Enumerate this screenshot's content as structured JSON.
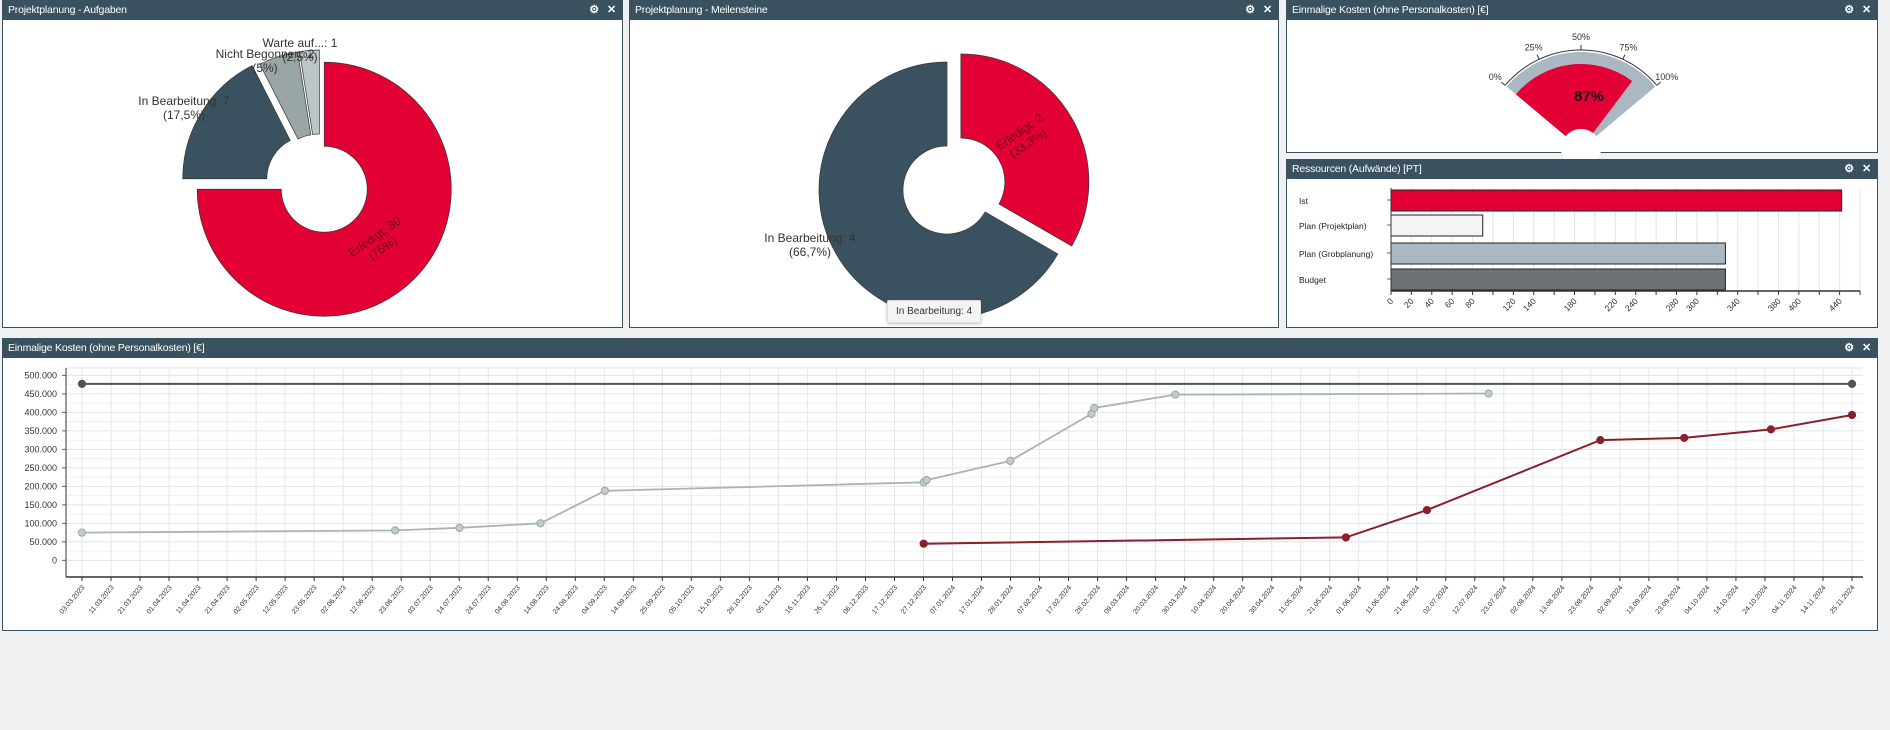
{
  "colors": {
    "header": "#3a525f",
    "red": "#e30034",
    "dark": "#3a525f",
    "gray": "#9aa5a6",
    "light": "#bcc5c8",
    "lineDark": "#4d5558",
    "lineGray": "#aab4b4",
    "lineRed": "#8b1f2b",
    "budget": "#6d7374",
    "grob": "#a9b8c2",
    "proj": "#f4f4f4"
  },
  "icons": {
    "settings": "gear-icon",
    "close": "close-icon",
    "settings_glyph": "⚙",
    "close_glyph": "✕"
  },
  "panels": {
    "tasks": {
      "title": "Projektplanung - Aufgaben"
    },
    "milestones": {
      "title": "Projektplanung - Meilensteine",
      "tooltip": "In Bearbeitung: 4"
    },
    "gauge": {
      "title": "Einmalige Kosten (ohne Personalkosten) [€]"
    },
    "resources": {
      "title": "Ressourcen (Aufwände) [PT]"
    },
    "costs": {
      "title": "Einmalige Kosten (ohne Personalkosten) [€]"
    }
  },
  "chart_data": [
    {
      "type": "pie",
      "id": "tasks",
      "slices": [
        {
          "label": "Erledigt: 30",
          "pct": "(75%)",
          "value": 30,
          "color": "#e30034"
        },
        {
          "label": "In Bearbeitung: 7",
          "pct": "(17,5%)",
          "value": 7,
          "color": "#3a525f"
        },
        {
          "label": "Nicht Begonnen: 2",
          "pct": "(5%)",
          "value": 2,
          "color": "#9aa5a6"
        },
        {
          "label": "Warte auf...: 1",
          "pct": "(2,5%)",
          "value": 1,
          "color": "#bcc5c8"
        }
      ]
    },
    {
      "type": "pie",
      "id": "milestones",
      "slices": [
        {
          "label": "Erledigt: 2",
          "pct": "(33,3%)",
          "value": 2,
          "color": "#e30034"
        },
        {
          "label": "In Bearbeitung: 4",
          "pct": "(66,7%)",
          "value": 4,
          "color": "#3a525f"
        }
      ]
    },
    {
      "type": "gauge",
      "id": "gauge",
      "value": 87,
      "value_label": "87%",
      "ticks": [
        "0%",
        "25%",
        "50%",
        "75%",
        "100%"
      ]
    },
    {
      "type": "bar",
      "id": "resources",
      "orientation": "horizontal",
      "categories": [
        "Ist",
        "Plan (Projektplan)",
        "Plan (Grobplanung)",
        "Budget"
      ],
      "values": [
        442,
        90,
        328,
        328
      ],
      "colors": [
        "#e30034",
        "#f4f4f4",
        "#a9b8c2",
        "#6d7374"
      ],
      "xlim": [
        0,
        460
      ],
      "tick_labels": [
        "0",
        "20",
        "40",
        "60",
        "80",
        "120",
        "140",
        "180",
        "220",
        "240",
        "280",
        "300",
        "340",
        "380",
        "400",
        "440"
      ],
      "grid": true
    },
    {
      "type": "line",
      "id": "costs",
      "ylim": [
        -45000,
        520000
      ],
      "y_ticks": [
        "500.000",
        "450.000",
        "400.000",
        "350.000",
        "300.000",
        "250.000",
        "200.000",
        "150.000",
        "100.000",
        "50.000",
        "0"
      ],
      "x_ticks": [
        "03.03.2023",
        "11.03.2023",
        "21.03.2023",
        "01.04.2023",
        "11.04.2023",
        "21.04.2023",
        "02.05.2023",
        "12.05.2023",
        "23.05.2023",
        "02.06.2023",
        "12.06.2023",
        "23.06.2023",
        "03.07.2023",
        "14.07.2023",
        "24.07.2023",
        "04.08.2023",
        "14.08.2023",
        "24.08.2023",
        "04.09.2023",
        "14.09.2023",
        "25.09.2023",
        "05.10.2023",
        "15.10.2023",
        "26.10.2023",
        "05.11.2023",
        "16.11.2023",
        "26.11.2023",
        "06.12.2023",
        "17.12.2023",
        "27.12.2023",
        "07.01.2024",
        "17.01.2024",
        "28.01.2024",
        "07.02.2024",
        "17.02.2024",
        "28.02.2024",
        "09.03.2024",
        "20.03.2024",
        "30.03.2024",
        "10.04.2024",
        "20.04.2024",
        "30.04.2024",
        "11.05.2024",
        "21.05.2024",
        "01.06.2024",
        "11.06.2024",
        "21.06.2024",
        "02.07.2024",
        "12.07.2024",
        "23.07.2024",
        "02.08.2024",
        "13.08.2024",
        "23.08.2024",
        "02.09.2024",
        "13.09.2024",
        "23.09.2024",
        "04.10.2024",
        "14.10.2024",
        "24.10.2024",
        "04.11.2024",
        "14.11.2024",
        "25.11.2024"
      ],
      "grid": true,
      "series": [
        {
          "color": "#4d5558",
          "points": [
            [
              "03.03.2023",
              477000
            ],
            [
              "25.11.2024",
              477000
            ]
          ]
        },
        {
          "color": "#aab4b4",
          "points": [
            [
              "03.03.2023",
              75000
            ],
            [
              "23.06.2023",
              81000
            ],
            [
              "16.07.2023",
              88000
            ],
            [
              "14.08.2023",
              100000
            ],
            [
              "06.09.2023",
              188000
            ],
            [
              "29.12.2023",
              211000
            ],
            [
              "30.12.2023",
              217000
            ],
            [
              "29.01.2024",
              269000
            ],
            [
              "27.02.2024",
              396000
            ],
            [
              "28.02.2024",
              412000
            ],
            [
              "28.03.2024",
              448000
            ],
            [
              "18.07.2024",
              451000
            ]
          ]
        },
        {
          "color": "#8b1f2b",
          "points": [
            [
              "29.12.2023",
              45000
            ],
            [
              "28.05.2024",
              62000
            ],
            [
              "26.06.2024",
              136000
            ],
            [
              "27.08.2024",
              325000
            ],
            [
              "26.09.2024",
              331000
            ],
            [
              "27.10.2024",
              354000
            ],
            [
              "25.11.2024",
              393000
            ]
          ]
        }
      ]
    }
  ]
}
